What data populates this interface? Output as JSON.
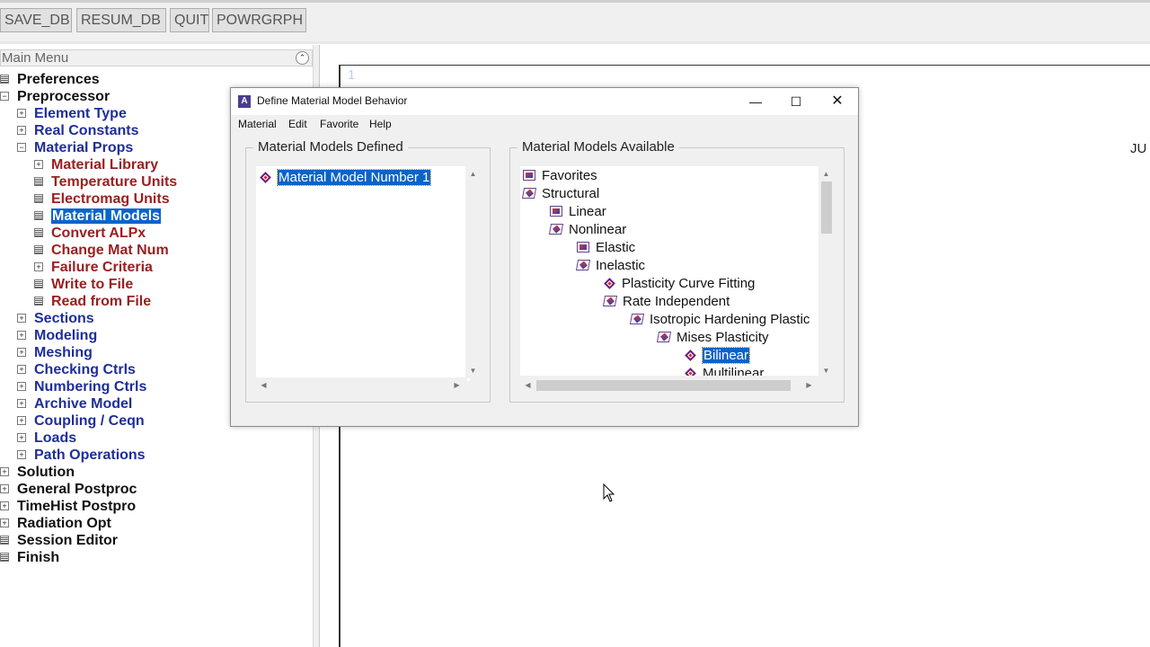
{
  "toolbar": {
    "buttons": [
      "SAVE_DB",
      "RESUM_DB",
      "QUIT",
      "POWRGRPH"
    ]
  },
  "main_menu": {
    "title": "Main Menu",
    "items": [
      {
        "label": "Preferences",
        "icon": "doc",
        "expander": "",
        "color": "black"
      },
      {
        "label": "Preprocessor",
        "icon": "minus",
        "expander": "⊟",
        "color": "black"
      },
      {
        "label": "Element Type",
        "icon": "plus",
        "expander": "⊞",
        "color": "blue"
      },
      {
        "label": "Real Constants",
        "icon": "plus",
        "expander": "⊞",
        "color": "blue"
      },
      {
        "label": "Material Props",
        "icon": "minus",
        "expander": "⊟",
        "color": "blue"
      },
      {
        "label": "Material Library",
        "icon": "plus",
        "expander": "⊞",
        "color": "red"
      },
      {
        "label": "Temperature Units",
        "icon": "doc",
        "expander": "",
        "color": "red"
      },
      {
        "label": "Electromag Units",
        "icon": "doc",
        "expander": "",
        "color": "red"
      },
      {
        "label": "Material Models",
        "icon": "doc",
        "expander": "",
        "color": "selected"
      },
      {
        "label": "Convert ALPx",
        "icon": "doc",
        "expander": "",
        "color": "red"
      },
      {
        "label": "Change Mat Num",
        "icon": "doc",
        "expander": "",
        "color": "red"
      },
      {
        "label": "Failure Criteria",
        "icon": "plus",
        "expander": "⊞",
        "color": "red"
      },
      {
        "label": "Write to File",
        "icon": "doc",
        "expander": "",
        "color": "red"
      },
      {
        "label": "Read from File",
        "icon": "doc",
        "expander": "",
        "color": "red"
      },
      {
        "label": "Sections",
        "icon": "plus",
        "expander": "⊞",
        "color": "blue"
      },
      {
        "label": "Modeling",
        "icon": "plus",
        "expander": "⊞",
        "color": "blue"
      },
      {
        "label": "Meshing",
        "icon": "plus",
        "expander": "⊞",
        "color": "blue"
      },
      {
        "label": "Checking Ctrls",
        "icon": "plus",
        "expander": "⊞",
        "color": "blue"
      },
      {
        "label": "Numbering Ctrls",
        "icon": "plus",
        "expander": "⊞",
        "color": "blue"
      },
      {
        "label": "Archive Model",
        "icon": "plus",
        "expander": "⊞",
        "color": "blue"
      },
      {
        "label": "Coupling / Ceqn",
        "icon": "plus",
        "expander": "⊞",
        "color": "blue"
      },
      {
        "label": "Loads",
        "icon": "plus",
        "expander": "⊞",
        "color": "blue"
      },
      {
        "label": "Path Operations",
        "icon": "plus",
        "expander": "⊞",
        "color": "blue"
      },
      {
        "label": "Solution",
        "icon": "plus",
        "expander": "⊞",
        "color": "black"
      },
      {
        "label": "General Postproc",
        "icon": "plus",
        "expander": "⊞",
        "color": "black"
      },
      {
        "label": "TimeHist Postpro",
        "icon": "plus",
        "expander": "⊞",
        "color": "black"
      },
      {
        "label": "Radiation Opt",
        "icon": "plus",
        "expander": "⊞",
        "color": "black"
      },
      {
        "label": "Session Editor",
        "icon": "doc",
        "expander": "",
        "color": "black"
      },
      {
        "label": "Finish",
        "icon": "doc",
        "expander": "",
        "color": "black"
      }
    ]
  },
  "graphics": {
    "line_number": "1",
    "corner_text": "JU"
  },
  "dialog": {
    "app_icon_letter": "A",
    "title": "Define Material Model Behavior",
    "controls": {
      "minimize": "—",
      "maximize": "☐",
      "close": "✕"
    },
    "menus": [
      "Material",
      "Edit",
      "Favorite",
      "Help"
    ],
    "defined": {
      "label": "Material Models Defined",
      "items": [
        "Material Model Number 1"
      ]
    },
    "available": {
      "label": "Material Models Available",
      "nodes": [
        {
          "label": "Favorites",
          "icon": "folder",
          "selected": false
        },
        {
          "label": "Structural",
          "icon": "folder-open",
          "selected": false
        },
        {
          "label": "Linear",
          "icon": "folder",
          "selected": false
        },
        {
          "label": "Nonlinear",
          "icon": "folder-open",
          "selected": false
        },
        {
          "label": "Elastic",
          "icon": "folder",
          "selected": false
        },
        {
          "label": "Inelastic",
          "icon": "folder-open",
          "selected": false
        },
        {
          "label": "Plasticity Curve Fitting",
          "icon": "diamond",
          "selected": false
        },
        {
          "label": "Rate Independent",
          "icon": "folder-open",
          "selected": false
        },
        {
          "label": "Isotropic Hardening Plastic",
          "icon": "folder-open",
          "selected": false
        },
        {
          "label": "Mises Plasticity",
          "icon": "folder-open",
          "selected": false
        },
        {
          "label": "Bilinear",
          "icon": "diamond",
          "selected": true
        },
        {
          "label": "Multilinear",
          "icon": "diamond",
          "selected": false
        }
      ]
    }
  }
}
